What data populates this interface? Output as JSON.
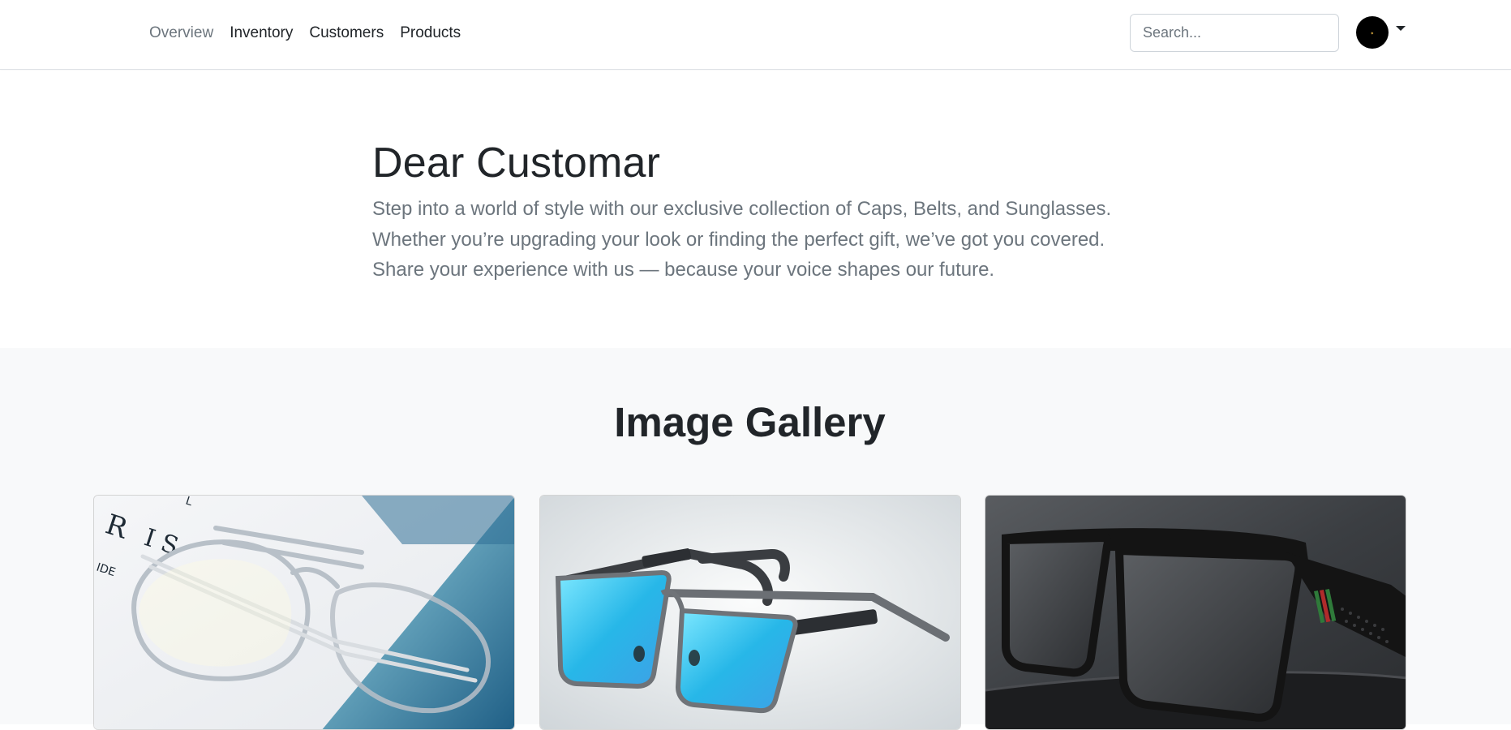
{
  "nav": {
    "links": [
      "Overview",
      "Inventory",
      "Customers",
      "Products"
    ],
    "active": "Overview"
  },
  "search": {
    "placeholder": "Search..."
  },
  "user": {
    "avatar_icon": "brand-logo-avatar",
    "menu_icon": "caret-down-icon"
  },
  "hero": {
    "title": "Dear Customar",
    "lines": [
      "Step into a world of style with our exclusive collection of Caps, Belts, and Sunglasses.",
      "Whether you’re upgrading your look or finding the perfect gift, we’ve got you covered.",
      "Share your experience with us — because your voice shapes our future."
    ]
  },
  "gallery": {
    "title": "Image Gallery",
    "images": [
      {
        "name": "clear-aviator-eyeglasses-image"
      },
      {
        "name": "blue-mirrored-sunglasses-image"
      },
      {
        "name": "black-square-sunglasses-image"
      }
    ]
  },
  "colors": {
    "text": "#212529",
    "muted": "#6c757d",
    "gallery_bg": "#f8f9fa",
    "border": "#dee2e6"
  }
}
